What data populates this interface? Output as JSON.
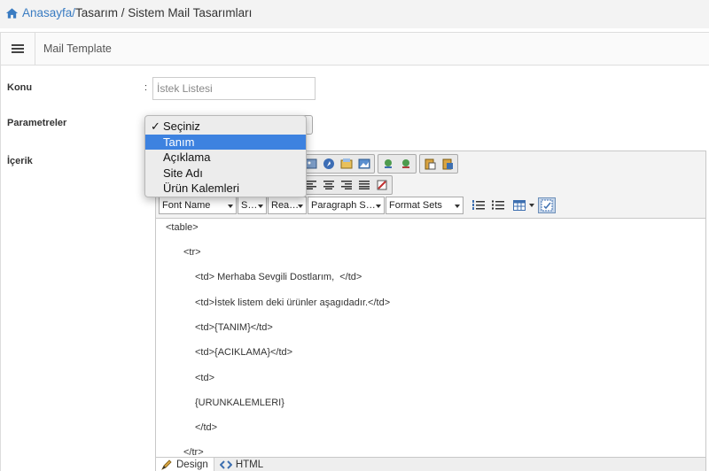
{
  "breadcrumb": {
    "home": "Anasayfa/",
    "trail": " Tasarım / Sistem Mail Tasarımları"
  },
  "panel": {
    "title": "Mail Template"
  },
  "form": {
    "konu_label": "Konu",
    "colon": ":",
    "konu_value": "İstek Listesi",
    "parametreler_label": "Parametreler",
    "icerik_label": "İçerik"
  },
  "dropdown": {
    "checkmark": "✓",
    "options": [
      "Seçiniz",
      "Tanım",
      "Açıklama",
      "Site Adı",
      "Ürün Kalemleri"
    ],
    "checked_index": 0,
    "highlighted_index": 1
  },
  "editor": {
    "combos": [
      "Font Name",
      "S…",
      "Rea…",
      "Paragraph S…",
      "Format Sets"
    ],
    "lines": [
      "<table>",
      "<tr>",
      "<td> Merhaba Sevgili Dostlarım,  </td>",
      "<td>İstek listem deki ürünler aşagıdadır.</td>",
      "<td>{TANIM}</td>",
      "<td>{ACIKLAMA}</td>",
      "<td>",
      "{URUNKALEMLERI}",
      "</td>",
      "</tr>"
    ],
    "tabs": {
      "design": "Design",
      "html": "HTML"
    }
  },
  "colors": {
    "link": "#3a7cc2",
    "highlight": "#3d82e0"
  }
}
